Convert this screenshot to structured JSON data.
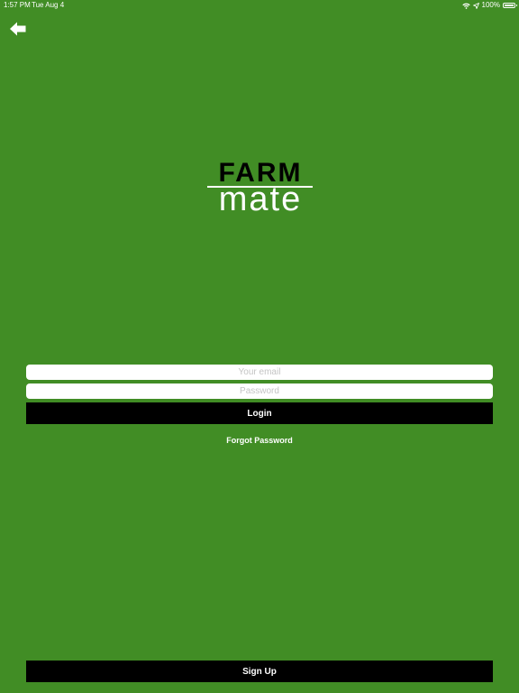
{
  "status_bar": {
    "time": "1:57 PM",
    "date": "Tue Aug 4",
    "battery": "100%",
    "icons": [
      "wifi-icon",
      "location-arrow-icon",
      "battery-icon"
    ]
  },
  "nav": {
    "back_icon": "back-arrow-icon"
  },
  "logo": {
    "top_text": "FARM",
    "bottom_text": "mate"
  },
  "form": {
    "email_placeholder": "Your email",
    "email_value": "",
    "password_placeholder": "Password",
    "password_value": "",
    "login_label": "Login",
    "forgot_label": "Forgot Password"
  },
  "footer": {
    "signup_label": "Sign Up"
  },
  "colors": {
    "background": "#418d25",
    "button": "#000000",
    "text": "#ffffff"
  }
}
